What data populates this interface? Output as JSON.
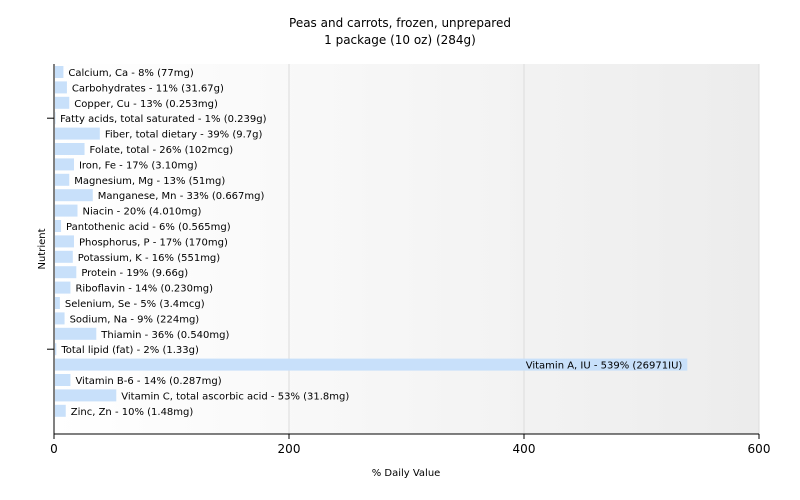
{
  "chart_data": {
    "type": "bar",
    "orientation": "horizontal",
    "title": "Peas and carrots, frozen, unprepared",
    "subtitle": "1 package (10 oz) (284g)",
    "xlabel": "% Daily Value",
    "ylabel": "Nutrient",
    "xlim": [
      0,
      600
    ],
    "xticks": [
      0,
      200,
      400,
      600
    ],
    "grid": true,
    "bar_color": "#c8e0fa",
    "series": [
      {
        "categories": [
          "Calcium, Ca",
          "Carbohydrates",
          "Copper, Cu",
          "Fatty acids, total saturated",
          "Fiber, total dietary",
          "Folate, total",
          "Iron, Fe",
          "Magnesium, Mg",
          "Manganese, Mn",
          "Niacin",
          "Pantothenic acid",
          "Phosphorus, P",
          "Potassium, K",
          "Protein",
          "Riboflavin",
          "Selenium, Se",
          "Sodium, Na",
          "Thiamin",
          "Total lipid (fat)",
          "Vitamin A, IU",
          "Vitamin B-6",
          "Vitamin C, total ascorbic acid",
          "Zinc, Zn"
        ],
        "values": [
          8,
          11,
          13,
          1,
          39,
          26,
          17,
          13,
          33,
          20,
          6,
          17,
          16,
          19,
          14,
          5,
          9,
          36,
          2,
          539,
          14,
          53,
          10
        ],
        "labels": [
          "Calcium, Ca - 8% (77mg)",
          "Carbohydrates - 11% (31.67g)",
          "Copper, Cu - 13% (0.253mg)",
          "Fatty acids, total saturated - 1% (0.239g)",
          "Fiber, total dietary - 39% (9.7g)",
          "Folate, total - 26% (102mcg)",
          "Iron, Fe - 17% (3.10mg)",
          "Magnesium, Mg - 13% (51mg)",
          "Manganese, Mn - 33% (0.667mg)",
          "Niacin - 20% (4.010mg)",
          "Pantothenic acid - 6% (0.565mg)",
          "Phosphorus, P - 17% (170mg)",
          "Potassium, K - 16% (551mg)",
          "Protein - 19% (9.66g)",
          "Riboflavin - 14% (0.230mg)",
          "Selenium, Se - 5% (3.4mcg)",
          "Sodium, Na - 9% (224mg)",
          "Thiamin - 36% (0.540mg)",
          "Total lipid (fat) - 2% (1.33g)",
          "Vitamin A, IU - 539% (26971IU)",
          "Vitamin B-6 - 14% (0.287mg)",
          "Vitamin C, total ascorbic acid - 53% (31.8mg)",
          "Zinc, Zn - 10% (1.48mg)"
        ]
      }
    ]
  }
}
